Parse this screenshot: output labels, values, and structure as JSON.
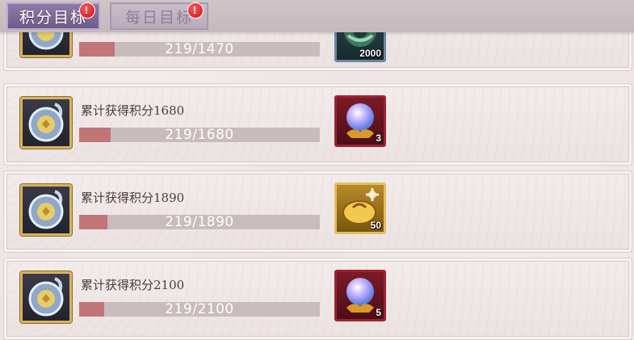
{
  "tabs": [
    {
      "label": "积分目标",
      "active": true,
      "badge": "!"
    },
    {
      "label": "每日目标",
      "active": false,
      "badge": "!"
    }
  ],
  "rows": [
    {
      "title": "",
      "progress_text": "219/1470",
      "progress": 0.149,
      "reward_icon": "jade-disc-icon",
      "reward_count": "2000"
    },
    {
      "title": "累计获得积分1680",
      "progress_text": "219/1680",
      "progress": 0.13,
      "reward_icon": "crystal-orb-icon",
      "reward_count": "3"
    },
    {
      "title": "累计获得积分1890",
      "progress_text": "219/1890",
      "progress": 0.116,
      "reward_icon": "gold-pouch-icon",
      "reward_count": "50"
    },
    {
      "title": "累计获得积分2100",
      "progress_text": "219/2100",
      "progress": 0.104,
      "reward_icon": "crystal-orb-icon",
      "reward_count": "5"
    }
  ],
  "colors": {
    "tab_active": "#7d6a99",
    "progress_fill": "#c07576",
    "progress_track": "#c9bcbd",
    "reward_red_frame": "#9c2230",
    "reward_gold_frame": "#e2bf5c"
  }
}
